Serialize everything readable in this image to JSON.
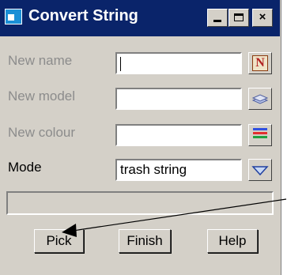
{
  "window": {
    "title": "Convert String",
    "title_icon": "app-window-icon",
    "controls": [
      "minimize-icon",
      "maximize-icon",
      "close-icon"
    ],
    "close_glyph": "×"
  },
  "form": {
    "new_name": {
      "label": "New name",
      "value": "",
      "button_icon": "name-n-icon",
      "button_glyph": "N"
    },
    "new_model": {
      "label": "New model",
      "value": "",
      "button_icon": "model-layers-icon"
    },
    "new_colour": {
      "label": "New colour",
      "value": "",
      "button_icon": "colour-bars-icon",
      "bar_colors": [
        "#3050e0",
        "#e03030",
        "#20a040"
      ]
    },
    "mode": {
      "label": "Mode",
      "value": "trash string",
      "button_icon": "chevron-down-icon"
    }
  },
  "message": "",
  "buttons": {
    "pick": "Pick",
    "finish": "Finish",
    "help": "Help"
  },
  "colors": {
    "titlebar": "#0a246a",
    "face": "#d4d0c8",
    "disabled_text": "#8c8c8c"
  }
}
